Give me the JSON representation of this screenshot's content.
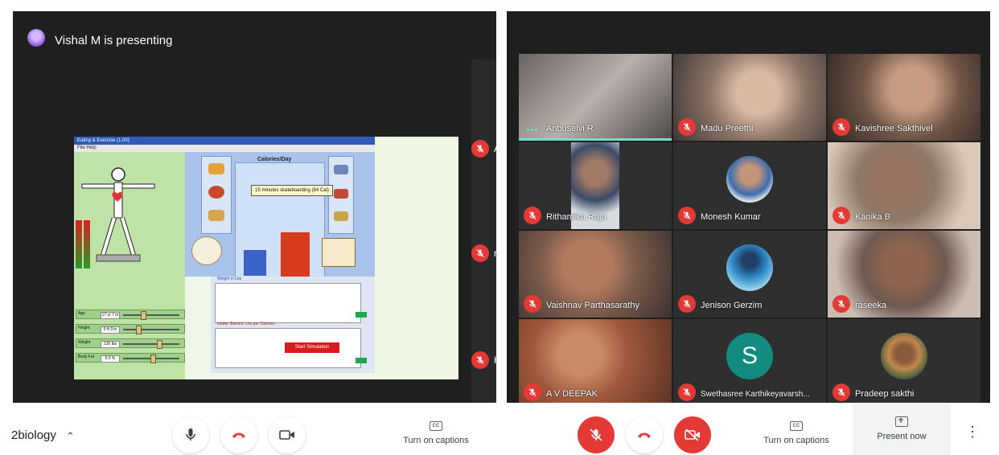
{
  "left_window": {
    "presenter_text": "Vishal M is presenting",
    "side_participants": [
      {
        "name": "A V"
      },
      {
        "name": "ras"
      },
      {
        "name": "Ka"
      }
    ],
    "simulation": {
      "window_title": "Eating & Exercise (1.00)",
      "menu": "File  Help",
      "chart_title": "Calories/Day",
      "tooltip": "15 minutes skateboarding (84 Cal)",
      "graph1_label": "Weight in Lbs",
      "graph2_label": "Intake: Burned: Lbs per Calories",
      "start_button": "Start Simulation",
      "inputs": [
        {
          "label": "Age",
          "value": "17 yr 7 m"
        },
        {
          "label": "Height",
          "value": "5 ft  9 in"
        },
        {
          "label": "Weight",
          "value": "130 lbs"
        },
        {
          "label": "Body Fat",
          "value": "0.0 %"
        }
      ]
    },
    "meeting_code": "2biology",
    "caption_label": "Turn on captions"
  },
  "right_window": {
    "participants": [
      {
        "name": "Anbuselvi R",
        "muted": false,
        "speaking": true
      },
      {
        "name": "Madu Preethi",
        "muted": true
      },
      {
        "name": "Kavishree Sakthivel",
        "muted": true
      },
      {
        "name": "Rithamika Raja",
        "muted": true
      },
      {
        "name": "Monesh Kumar",
        "muted": true
      },
      {
        "name": "Kanika B",
        "muted": true
      },
      {
        "name": "Vaishnav Parthasarathy",
        "muted": true
      },
      {
        "name": "Jenison Gerzim",
        "muted": true
      },
      {
        "name": "raseeka",
        "muted": true
      },
      {
        "name": "A V DEEPAK",
        "muted": true
      },
      {
        "name": "Swethasree Karthikeyavarsh...",
        "muted": true,
        "avatar_letter": "S"
      },
      {
        "name": "Pradeep sakthi",
        "muted": true
      }
    ],
    "caption_label": "Turn on captions",
    "present_label": "Present now"
  },
  "colors": {
    "danger_red": "#e53935",
    "speaking_teal": "#6fe0c6",
    "letter_avatar": "#128b80"
  }
}
